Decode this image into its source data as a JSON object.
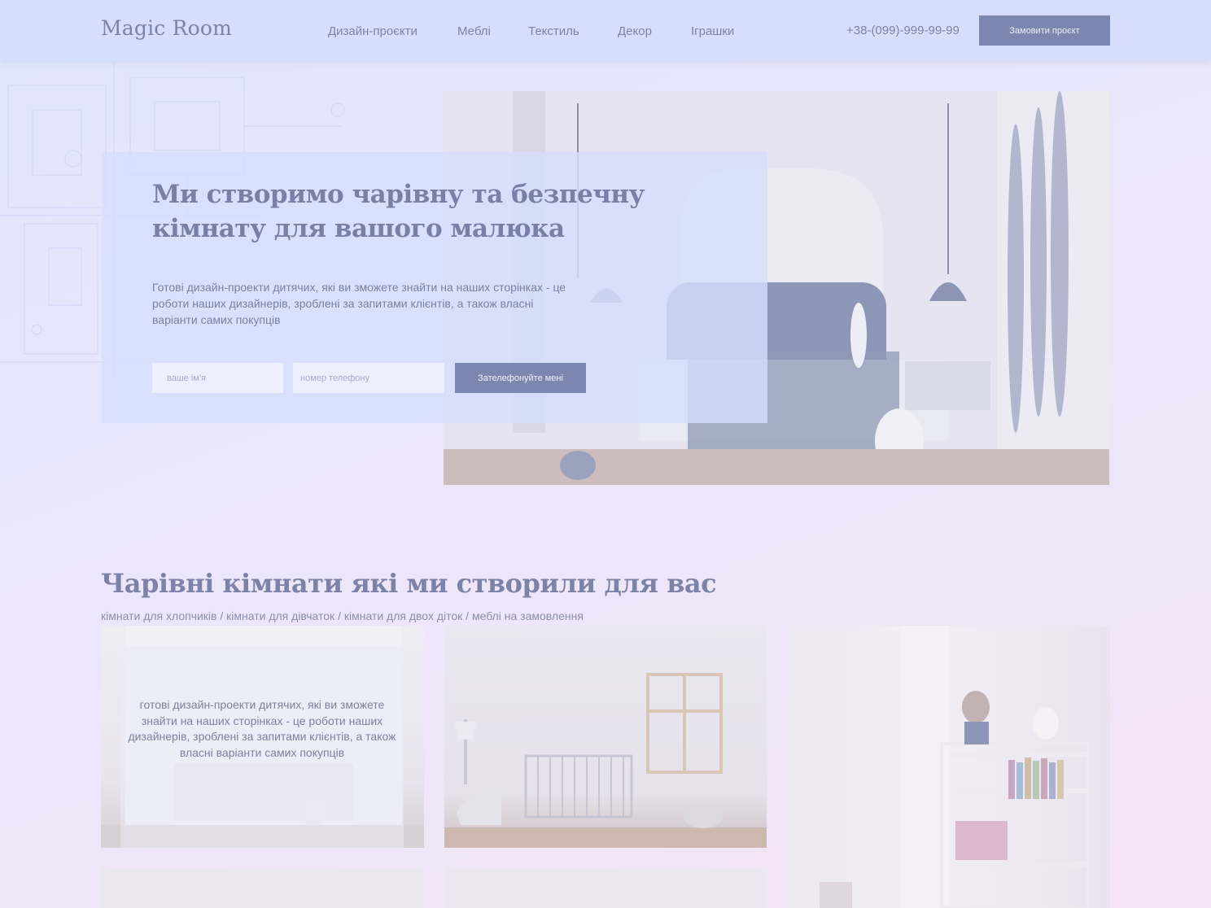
{
  "header": {
    "logo": "Magic Room",
    "nav": [
      "Дизайн-проєкти",
      "Меблі",
      "Текстиль",
      "Декор",
      "Іграшки"
    ],
    "phone": "+38-(099)-999-99-99",
    "order_button": "Замовити проєкт"
  },
  "hero": {
    "title": "Ми створимо чарівну та безпечну кімнату для вашого малюка",
    "text": "Готові дизайн-проекти дитячих, які ви зможете знайти на наших сторінках - це роботи наших дизайнерів, зроблені за запитами клієнтів, а також власні варіанти самих покупців",
    "name_placeholder": "ваше ім'я",
    "phone_placeholder": "номер телефону",
    "call_button": "Зателефонуйте мені"
  },
  "gallery": {
    "title": "Чарівні кімнати які ми створили для вас",
    "filters": [
      "кімнати для хлопчиків",
      "кімнати для дівчаток",
      "кімнати для двох діток",
      "меблі на замовлення"
    ],
    "separator": " / ",
    "tile_text": "готові дизайн-проекти дитячих, які ви зможете знайти на наших сторінках - це роботи наших дизайнерів, зроблені за запитами клієнтів, а також власні варіанти самих покупців"
  },
  "colors": {
    "accent": "#7c87b0",
    "text": "#7d83a8",
    "header_bg": "#d2dcfc"
  }
}
